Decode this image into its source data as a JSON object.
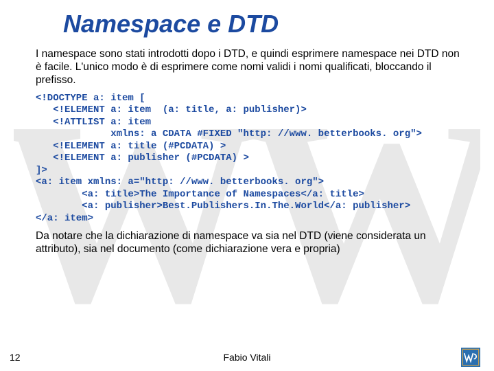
{
  "title": "Namespace e DTD",
  "para1": "I namespace sono stati introdotti dopo i DTD, e quindi esprimere namespace nei DTD non è facile.  L'unico modo è di esprimere come nomi validi i nomi qualificati, bloccando il prefisso.",
  "code": "<!DOCTYPE a: item [\n   <!ELEMENT a: item  (a: title, a: publisher)>\n   <!ATTLIST a: item\n             xmlns: a CDATA #FIXED \"http: //www. betterbooks. org\">\n   <!ELEMENT a: title (#PCDATA) >\n   <!ELEMENT a: publisher (#PCDATA) >\n]>\n<a: item xmlns: a=\"http: //www. betterbooks. org\">\n        <a: title>The Importance of Namespaces</a: title>\n        <a: publisher>Best.Publishers.In.The.World</a: publisher>\n</a: item>",
  "para2": "Da notare che la dichiarazione di namespace va sia nel DTD (viene considerata un attributo), sia nel documento (come dichiarazione vera e propria)",
  "footer": {
    "page": "12",
    "author": "Fabio Vitali"
  },
  "watermark": "WW"
}
